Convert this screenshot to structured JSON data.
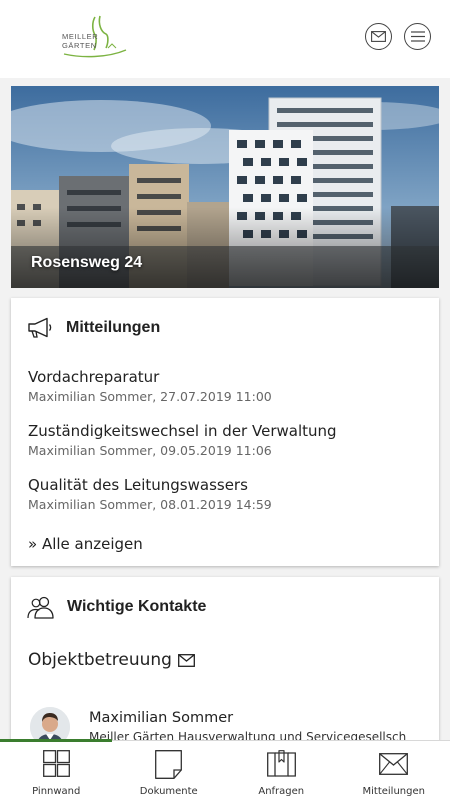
{
  "header": {
    "logo_line1": "MEILLER",
    "logo_line2": "GÄRTEN",
    "mail_icon": "envelope-icon",
    "menu_icon": "hamburger-menu-icon"
  },
  "hero": {
    "title": "Rosensweg 24"
  },
  "news": {
    "title": "Mitteilungen",
    "icon": "megaphone-icon",
    "items": [
      {
        "title": "Vordachreparatur",
        "meta": "Maximilian Sommer, 27.07.2019 11:00"
      },
      {
        "title": "Zuständigkeitswechsel in der Verwaltung",
        "meta": "Maximilian Sommer, 09.05.2019 11:06"
      },
      {
        "title": "Qualität des Leitungswassers",
        "meta": "Maximilian Sommer, 08.01.2019 14:59"
      }
    ],
    "show_all": "» Alle anzeigen"
  },
  "contacts": {
    "title": "Wichtige Kontakte",
    "icon": "people-icon",
    "section": "Objektbetreuung",
    "person": {
      "name": "Maximilian Sommer",
      "company": "Meiller Gärten Hausverwaltung und Servicegesellsch"
    }
  },
  "bottom_nav": {
    "active_color": "#3a7d2e",
    "items": [
      {
        "label": "Pinnwand",
        "icon": "grid-icon"
      },
      {
        "label": "Dokumente",
        "icon": "document-icon"
      },
      {
        "label": "Anfragen",
        "icon": "request-icon"
      },
      {
        "label": "Mitteilungen",
        "icon": "envelope-icon"
      }
    ]
  }
}
